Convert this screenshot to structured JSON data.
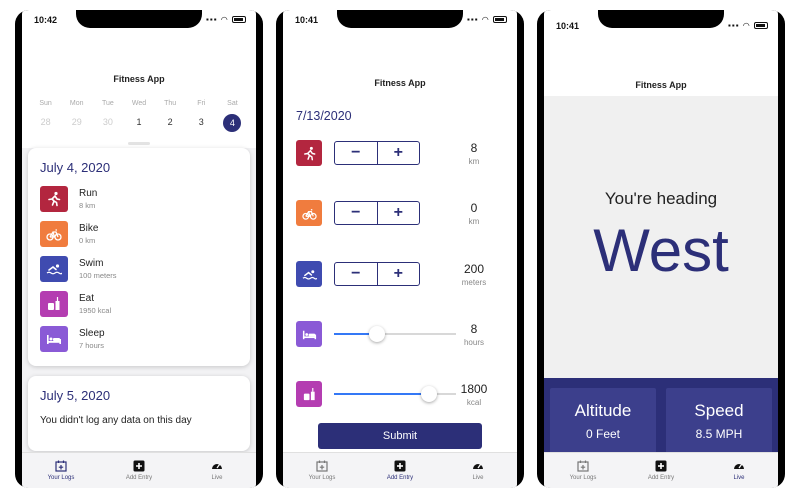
{
  "app_title": "Fitness App",
  "tabs": [
    {
      "label": "Your Logs",
      "icon": "calendar-plus-icon"
    },
    {
      "label": "Add Entry",
      "icon": "plus-square-icon"
    },
    {
      "label": "Live",
      "icon": "speedometer-icon"
    }
  ],
  "colors": {
    "accent": "#2c2f78",
    "run": "#b3263f",
    "bike": "#f07c3e",
    "swim": "#3f4bb0",
    "eat": "#b43db1",
    "sleep": "#8a5ad6",
    "slider_fill": "#3478f6"
  },
  "logs_screen": {
    "status_time": "10:42",
    "week_days": [
      {
        "name": "Sun",
        "num": "28",
        "state": "faded"
      },
      {
        "name": "Mon",
        "num": "29",
        "state": "faded"
      },
      {
        "name": "Tue",
        "num": "30",
        "state": "faded"
      },
      {
        "name": "Wed",
        "num": "1",
        "state": "normal"
      },
      {
        "name": "Thu",
        "num": "2",
        "state": "normal"
      },
      {
        "name": "Fri",
        "num": "3",
        "state": "normal"
      },
      {
        "name": "Sat",
        "num": "4",
        "state": "selected"
      }
    ],
    "card1": {
      "date": "July 4, 2020",
      "entries": [
        {
          "title": "Run",
          "sub": "8 km",
          "icon": "run-icon"
        },
        {
          "title": "Bike",
          "sub": "0 km",
          "icon": "bike-icon"
        },
        {
          "title": "Swim",
          "sub": "100 meters",
          "icon": "swim-icon"
        },
        {
          "title": "Eat",
          "sub": "1950 kcal",
          "icon": "eat-icon"
        },
        {
          "title": "Sleep",
          "sub": "7 hours",
          "icon": "sleep-icon"
        }
      ]
    },
    "card2": {
      "date": "July 5, 2020",
      "message": "You didn't log any data on this day"
    }
  },
  "add_screen": {
    "status_time": "10:41",
    "date": "7/13/2020",
    "stepper_minus": "−",
    "stepper_plus": "+",
    "rows": [
      {
        "kind": "stepper",
        "icon": "run-icon",
        "value": "8",
        "unit": "km"
      },
      {
        "kind": "stepper",
        "icon": "bike-icon",
        "value": "0",
        "unit": "km"
      },
      {
        "kind": "stepper",
        "icon": "swim-icon",
        "value": "200",
        "unit": "meters"
      },
      {
        "kind": "slider",
        "icon": "sleep-icon",
        "value": "8",
        "unit": "hours",
        "level": 0.35
      },
      {
        "kind": "slider",
        "icon": "eat-icon",
        "value": "1800",
        "unit": "kcal",
        "level": 0.78
      }
    ],
    "submit_label": "Submit"
  },
  "live_screen": {
    "status_time": "10:41",
    "heading_label": "You're heading",
    "direction": "West",
    "altitude_label": "Altitude",
    "altitude_value": "0 Feet",
    "speed_label": "Speed",
    "speed_value": "8.5 MPH"
  }
}
